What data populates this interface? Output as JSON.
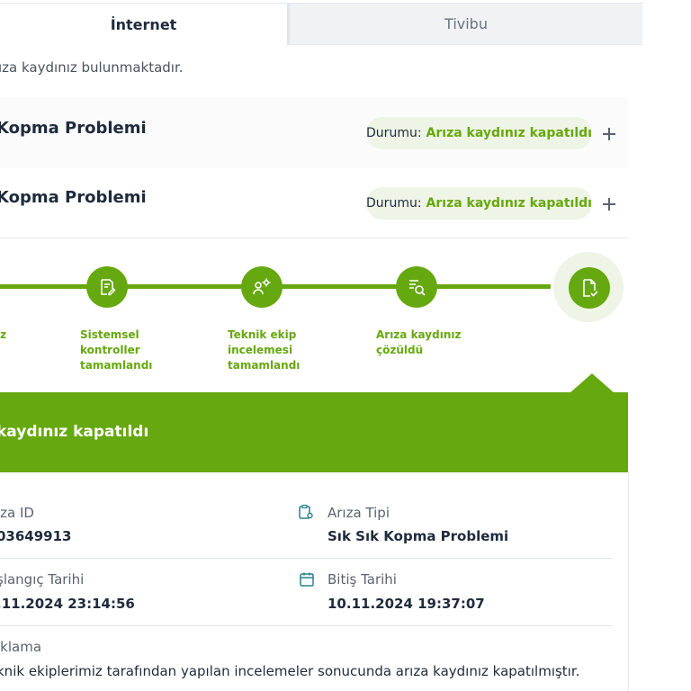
{
  "tabs": {
    "internet": "İnternet",
    "tivibu": "Tivibu"
  },
  "info_text": "ıza kaydınız bulunmaktadır.",
  "records": [
    {
      "title": "Kopma Problemi",
      "status_key": "Durumu:",
      "status_value": "Arıza kaydınız kapatıldı"
    },
    {
      "title": "Kopma Problemi",
      "status_key": "Durumu:",
      "status_value": "Arıza kaydınız kapatıldı"
    }
  ],
  "stepper": {
    "steps": [
      {
        "label": "ız",
        "icon": "check-icon"
      },
      {
        "label": "Sistemsel\nkontroller\ntamamlandı",
        "icon": "document-edit-icon"
      },
      {
        "label": "Teknik ekip\nincelemesi\ntamamlandı",
        "icon": "user-gear-icon"
      },
      {
        "label": "Arıza kaydınız\nçözüldü",
        "icon": "list-search-icon"
      },
      {
        "label": "",
        "icon": "document-check-icon"
      }
    ]
  },
  "panel": {
    "title": "kaydınız kapatıldı"
  },
  "details": {
    "fault_id_label": "ıza ID",
    "fault_id_value": "03649913",
    "fault_type_label": "Arıza Tipi",
    "fault_type_value": "Sık Sık Kopma Problemi",
    "start_label": "şlangıç Tarihi",
    "start_value": ".11.2024 23:14:56",
    "end_label": "Bitiş Tarihi",
    "end_value": "10.11.2024 19:37:07",
    "desc_label": "ıklama",
    "desc_value": "knik ekiplerimiz tarafından yapılan incelemeler sonucunda arıza kaydınız kapatılmıştır."
  },
  "colors": {
    "accent": "#66a80f",
    "badge_bg": "#eef4e6",
    "text": "#1f2a3c"
  }
}
